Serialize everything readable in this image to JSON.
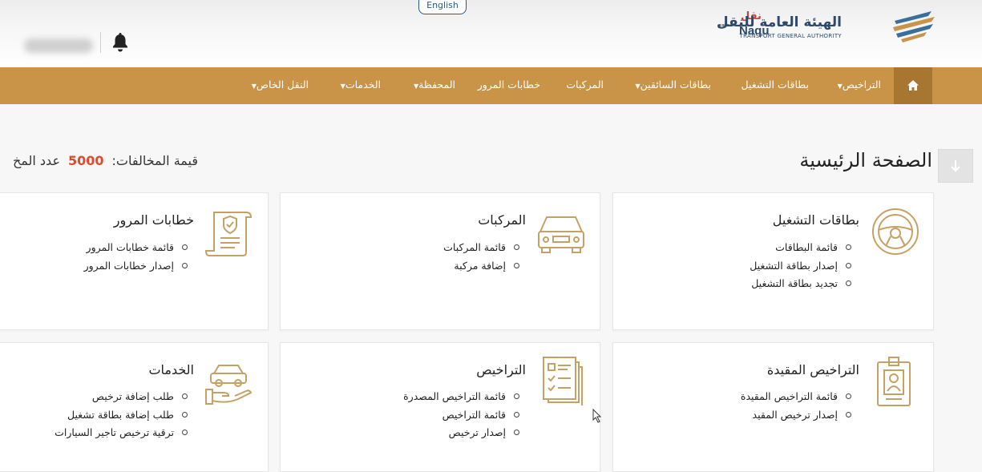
{
  "header": {
    "language_button": "English",
    "logo_arabic": "الهيئة العامة للنقل",
    "logo_english": "TRANSPORT GENERAL AUTHORITY",
    "naql_arabic": "نقل",
    "naql_latin": "Naqu"
  },
  "nav": {
    "home_icon": "home-icon",
    "items": [
      {
        "label": "التراخيص",
        "dropdown": true
      },
      {
        "label": "بطاقات التشغيل",
        "dropdown": false
      },
      {
        "label": "بطاقات السائقين",
        "dropdown": true
      },
      {
        "label": "المركبات",
        "dropdown": false
      },
      {
        "label": "خطابات المرور",
        "dropdown": false
      },
      {
        "label": "المحفظة",
        "dropdown": true
      },
      {
        "label": "الخدمات",
        "dropdown": true
      },
      {
        "label": "النقل الخاص",
        "dropdown": true
      }
    ]
  },
  "page": {
    "title": "الصفحة الرئيسية",
    "violations_label": "قيمة المخالفات:",
    "violations_value": "5000",
    "count_label": "عدد المخ"
  },
  "cards": [
    {
      "title": "بطاقات التشغيل",
      "icon": "steering-wheel-icon",
      "items": [
        "قائمة البطاقات",
        "إصدار بطاقة التشغيل",
        "تجديد بطاقة التشغيل"
      ]
    },
    {
      "title": "المركبات",
      "icon": "car-icon",
      "items": [
        "قائمة المركبات",
        "إضافة مركبة"
      ]
    },
    {
      "title": "خطابات المرور",
      "icon": "certificate-scroll-icon",
      "items": [
        "قائمة خطابات المرور",
        "إصدار خطابات المرور"
      ]
    },
    {
      "title": "التراخيص المقيدة",
      "icon": "id-badge-icon",
      "items": [
        "قائمة التراخيص المقيدة",
        "إصدار ترخيص المقيد"
      ]
    },
    {
      "title": "التراخيص",
      "icon": "checklist-icon",
      "items": [
        "قائمة التراخيص المصدرة",
        "قائمة التراخيص",
        "إصدار ترخيص"
      ]
    },
    {
      "title": "الخدمات",
      "icon": "hand-car-icon",
      "items": [
        "طلب إضافة ترخيص",
        "طلب إضافة بطاقة تشغيل",
        "ترقية ترخيص تاجير السيارات"
      ]
    }
  ],
  "colors": {
    "nav_bg": "#c99348",
    "nav_home_bg": "#a77732",
    "accent_number": "#e04a2c",
    "icon_gold": "#c5a166"
  }
}
